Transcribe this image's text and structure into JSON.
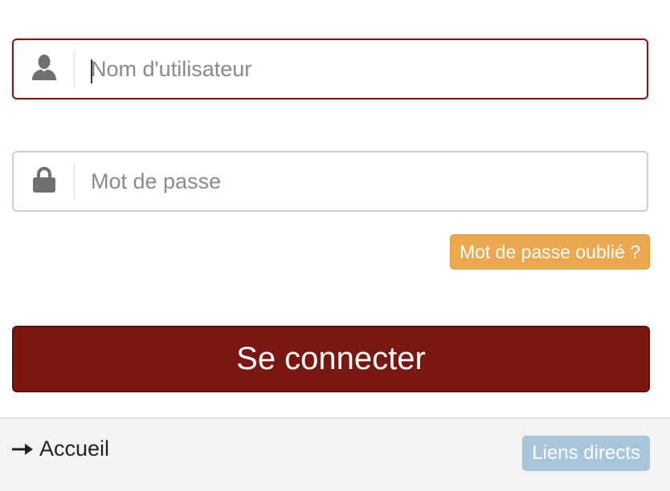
{
  "login_form": {
    "username": {
      "placeholder": "Nom d'utilisateur",
      "value": "",
      "icon": "user-icon",
      "focused": true
    },
    "password": {
      "placeholder": "Mot de passe",
      "value": "",
      "icon": "lock-icon"
    },
    "forgot_password_label": "Mot de passe oublié ?",
    "submit_label": "Se connecter"
  },
  "footer": {
    "home_link_label": "Accueil",
    "home_link_icon": "arrow-right-icon",
    "direct_links_label": "Liens directs"
  },
  "colors": {
    "primary": "#7a1711",
    "warning": "#eba84f",
    "info_disabled": "#a8c6d9",
    "footer_bg": "#f3f3f3"
  }
}
